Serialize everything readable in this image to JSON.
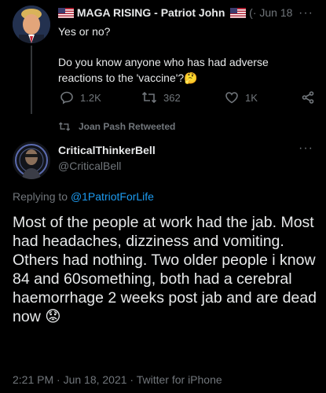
{
  "first_tweet": {
    "author_name": "MAGA RISING - Patriot John",
    "handle_partial": "(·",
    "date": "Jun 18",
    "more": "···",
    "text_line1": "Yes or no?",
    "text_line2": "Do you know anyone who has had adverse reactions to the 'vaccine'?",
    "text_emoji": "🤔",
    "actions": {
      "replies": "1.2K",
      "retweets": "362",
      "likes": "1K"
    }
  },
  "retweet_notice": "Joan Pash Retweeted",
  "main_tweet": {
    "author_name": "CriticalThinkerBell",
    "handle": "@CriticalBell",
    "more": "···",
    "replying_prefix": "Replying to ",
    "replying_to": "@1PatriotForLife",
    "text": "Most of the people at work had the jab. Most had headaches, dizziness and vomiting. Others had nothing. Two older people i know 84 and 60something, both had a cerebral haemorrhage 2 weeks post jab and are dead now",
    "text_emoji": "😟",
    "timestamp": "2:21 PM · Jun 18, 2021 · Twitter for iPhone"
  },
  "colors": {
    "background": "#000000",
    "text": "#e7e9ea",
    "muted": "#71767b",
    "link": "#1d9bf0"
  }
}
